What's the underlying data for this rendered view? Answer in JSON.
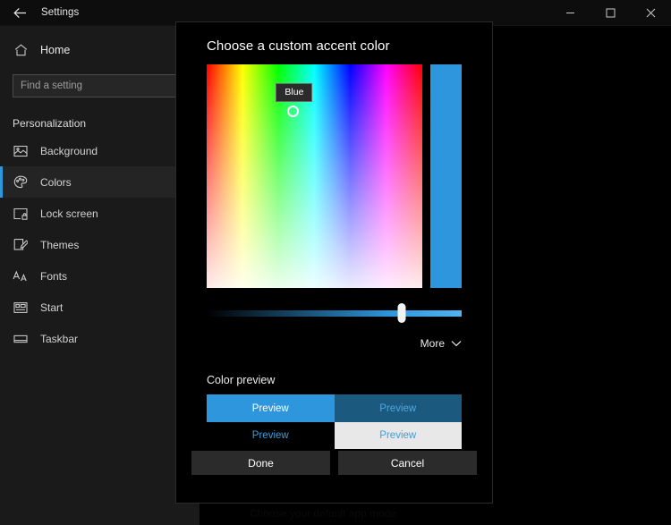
{
  "accent_color": "#2e96dc",
  "window": {
    "title": "Settings",
    "back_icon": "back-arrow-icon",
    "controls": {
      "minimize_label": "Minimize",
      "maximize_label": "Maximize",
      "close_label": "Close"
    }
  },
  "sidebar": {
    "home": {
      "label": "Home",
      "icon": "home-icon"
    },
    "search": {
      "placeholder": "Find a setting",
      "value": "",
      "icon": "search-icon"
    },
    "section_title": "Personalization",
    "items": [
      {
        "label": "Background",
        "icon": "image-icon",
        "selected": false
      },
      {
        "label": "Colors",
        "icon": "palette-icon",
        "selected": true
      },
      {
        "label": "Lock screen",
        "icon": "lockscreen-icon",
        "selected": false
      },
      {
        "label": "Themes",
        "icon": "themes-icon",
        "selected": false
      },
      {
        "label": "Fonts",
        "icon": "fonts-icon",
        "selected": false
      },
      {
        "label": "Start",
        "icon": "start-icon",
        "selected": false
      },
      {
        "label": "Taskbar",
        "icon": "taskbar-icon",
        "selected": false
      }
    ]
  },
  "main": {
    "obscured_text": "Choose your default app mode"
  },
  "dialog": {
    "title": "Choose a custom accent color",
    "spectrum": {
      "tooltip_label": "Blue",
      "picker_x_pct": 40,
      "picker_y_pct": 21,
      "swatch_color": "#2e96dc"
    },
    "brightness": {
      "value_pct": 76.5,
      "track_from": "#000000",
      "track_to": "#51b2ee"
    },
    "more": {
      "label": "More",
      "icon": "chevron-down-icon"
    },
    "preview": {
      "heading": "Color preview",
      "cells": [
        {
          "label": "Preview",
          "bg": "#2e96dc",
          "fg": "#ffffff"
        },
        {
          "label": "Preview",
          "bg": "#1b5a7e",
          "fg": "#4aa8e0"
        },
        {
          "label": "Preview",
          "bg": "#000000",
          "fg": "#3a9ede"
        },
        {
          "label": "Preview",
          "bg": "#e8e8e8",
          "fg": "#3a9ede"
        }
      ]
    },
    "buttons": {
      "done_label": "Done",
      "cancel_label": "Cancel"
    }
  }
}
